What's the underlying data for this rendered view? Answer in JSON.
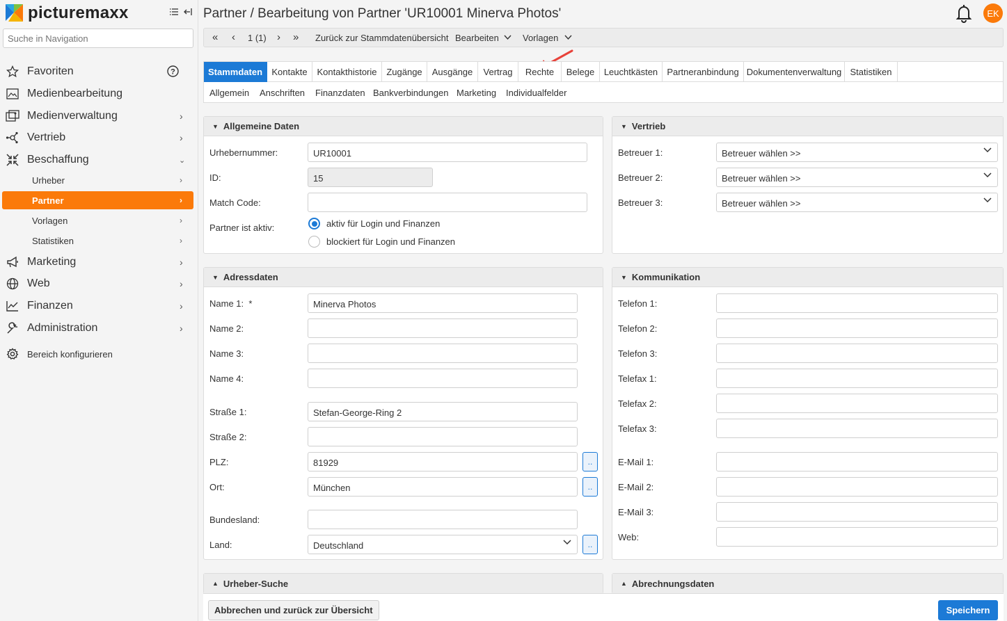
{
  "brand": {
    "name": "picturemaxx",
    "accent": "#fb7a0a",
    "primary": "#1c7ad6"
  },
  "sidebar": {
    "search_placeholder": "Suche in Navigation",
    "items": [
      {
        "label": "Favoriten",
        "icon": "star-icon"
      },
      {
        "label": "Medienbearbeitung",
        "icon": "image-edit-icon"
      },
      {
        "label": "Medienverwaltung",
        "icon": "media-library-icon"
      },
      {
        "label": "Vertrieb",
        "icon": "network-icon"
      },
      {
        "label": "Beschaffung",
        "icon": "collapse-arrows-icon"
      },
      {
        "label": "Marketing",
        "icon": "megaphone-icon"
      },
      {
        "label": "Web",
        "icon": "globe-icon"
      },
      {
        "label": "Finanzen",
        "icon": "chart-line-icon"
      },
      {
        "label": "Administration",
        "icon": "wrench-icon"
      },
      {
        "label": "Bereich konfigurieren",
        "icon": "gear-icon"
      }
    ],
    "sub_items": [
      {
        "label": "Urheber"
      },
      {
        "label": "Partner"
      },
      {
        "label": "Vorlagen"
      },
      {
        "label": "Statistiken"
      }
    ]
  },
  "header": {
    "title": "Partner / Bearbeitung von Partner 'UR10001 Minerva Photos'",
    "avatar": "EK"
  },
  "toolbar": {
    "page": "1 (1)",
    "back": "Zurück zur Stammdatenübersicht",
    "edit": "Bearbeiten",
    "templates": "Vorlagen"
  },
  "tabs": [
    "Stammdaten",
    "Kontakte",
    "Kontakthistorie",
    "Zugänge",
    "Ausgänge",
    "Vertrag",
    "Rechte",
    "Belege",
    "Leuchtkästen",
    "Partneranbindung",
    "Dokumentenverwaltung",
    "Statistiken"
  ],
  "subtabs": [
    "Allgemein",
    "Anschriften",
    "Finanzdaten",
    "Bankverbindungen",
    "Marketing",
    "Individualfelder"
  ],
  "general": {
    "title": "Allgemeine Daten",
    "urheber_label": "Urhebernummer:",
    "urheber_value": "UR10001",
    "id_label": "ID:",
    "id_value": "15",
    "match_label": "Match Code:",
    "match_value": "",
    "active_label": "Partner ist aktiv:",
    "radio_active": "aktiv für Login und Finanzen",
    "radio_blocked": "blockiert für Login und Finanzen"
  },
  "sales": {
    "title": "Vertrieb",
    "b1_label": "Betreuer 1:",
    "b2_label": "Betreuer 2:",
    "b3_label": "Betreuer 3:",
    "select_value": "Betreuer wählen >>"
  },
  "address": {
    "title": "Adressdaten",
    "name1_label": "Name 1:",
    "name1_req": "*",
    "name1_value": "Minerva Photos",
    "name2_label": "Name 2:",
    "name3_label": "Name 3:",
    "name4_label": "Name 4:",
    "street1_label": "Straße 1:",
    "street1_value": "Stefan-George-Ring 2",
    "street2_label": "Straße 2:",
    "zip_label": "PLZ:",
    "zip_value": "81929",
    "city_label": "Ort:",
    "city_value": "München",
    "state_label": "Bundesland:",
    "country_label": "Land:",
    "country_value": "Deutschland",
    "lookup": ".."
  },
  "communication": {
    "title": "Kommunikation",
    "labels": [
      "Telefon 1:",
      "Telefon 2:",
      "Telefon 3:",
      "Telefax 1:",
      "Telefax 2:",
      "Telefax 3:",
      "E-Mail 1:",
      "E-Mail 2:",
      "E-Mail 3:",
      "Web:"
    ]
  },
  "collapsed": {
    "author_search": "Urheber-Suche",
    "billing": "Abrechnungsdaten"
  },
  "footer": {
    "cancel": "Abbrechen und zurück zur Übersicht",
    "save": "Speichern"
  }
}
